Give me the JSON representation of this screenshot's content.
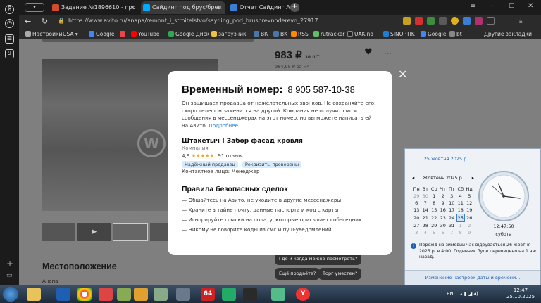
{
  "browser": {
    "tabs": [
      {
        "label": "Задание №1896610 - про",
        "fav_color": "#d44a2c",
        "active": false
      },
      {
        "label": "Сайдинг под брус/брев",
        "fav_color": "#00aaff",
        "active": true
      },
      {
        "label": "Отчет Сайдинг Анапа.png",
        "fav_color": "#3b7ed6",
        "active": false
      }
    ],
    "tab_count_badge": "9",
    "url": "https://www.avito.ru/anapa/remont_i_stroitelstvo/sayding_pod_brusbrevnoderevo_27917...",
    "bookmarks": [
      "Настройки",
      "USA",
      "Google",
      "YouTube",
      "Google Диск",
      "загрузчик",
      "ВК",
      "BK",
      "RSS",
      "rutracker",
      "UAKino",
      "SINOPTIK",
      "Google",
      "bt"
    ],
    "other_bookmarks": "Другие закладки"
  },
  "listing": {
    "price": "983 ₽",
    "price_unit": "за шт.",
    "price_sub": "984,95 ₽ за м²",
    "location_heading": "Местоположение",
    "location_text": "Анапа",
    "quick_questions": [
      "Где и когда можно посмотреть?",
      "Ещё продаёте?",
      "Торг уместен?"
    ]
  },
  "modal": {
    "title": "Временный номер:",
    "phone": "8 905 587-10-38",
    "description": "Он защищает продавца от нежелательных звонков. Не сохраняйте его: скоро телефон заменится на другой. Компания не получит смс и сообщения в мессенджерах на этот номер, но вы можете написать ей на Авито.",
    "more_link": "Подробнее",
    "seller_name": "Штакетыч I Забор фасад кровля",
    "seller_type": "Компания",
    "rating": "4,9",
    "stars": "★★★★★",
    "reviews": "91 отзыв",
    "badges": [
      "Надёжный продавец",
      "Реквизиты проверены"
    ],
    "contact": "Контактное лицо: Менеджер",
    "rules_title": "Правила безопасных сделок",
    "rules": [
      "Общайтесь на Авито, не уходите в другие мессенджеры",
      "Храните в тайне почту, данные паспорта и код с карты",
      "Игнорируйте ссылки на оплату, которые присылает собеседник",
      "Никому не говорите коды из смс и пуш-уведомлений"
    ]
  },
  "calendar": {
    "date_link": "25 жовтня 2025 р.",
    "month": "Жовтень 2025 р.",
    "weekdays": [
      "Пн",
      "Вт",
      "Ср",
      "Чт",
      "Пт",
      "Сб",
      "Нд"
    ],
    "weeks": [
      [
        "29",
        "30",
        "1",
        "2",
        "3",
        "4",
        "5"
      ],
      [
        "6",
        "7",
        "8",
        "9",
        "10",
        "11",
        "12"
      ],
      [
        "13",
        "14",
        "15",
        "16",
        "17",
        "18",
        "19"
      ],
      [
        "20",
        "21",
        "22",
        "23",
        "24",
        "25",
        "26"
      ],
      [
        "27",
        "28",
        "29",
        "30",
        "31",
        "1",
        "2"
      ],
      [
        "3",
        "4",
        "5",
        "6",
        "7",
        "8",
        "9"
      ]
    ],
    "selected_day": "25",
    "time": "12:47:50",
    "weekday_name": "субота",
    "notice": "Перехід на зимовий час відбувається 26 жовтня 2025 р. в 4:00. Годинник буде переведено на 1 час назад.",
    "settings_link": "Изменение настроек даты и времени..."
  },
  "taskbar": {
    "lang": "EN",
    "time": "12:47",
    "date": "25.10.2025"
  }
}
